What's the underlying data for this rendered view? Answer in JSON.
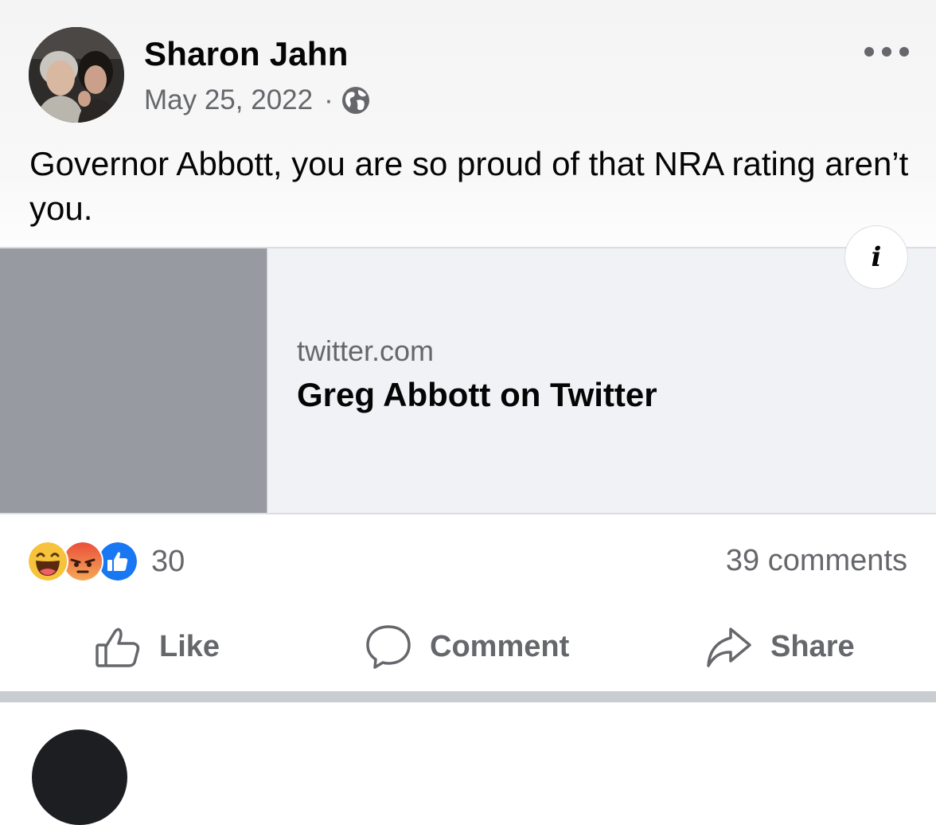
{
  "post": {
    "author": "Sharon Jahn",
    "date": "May 25, 2022",
    "separator_dot": "·",
    "privacy_icon": "globe-icon",
    "text": "Governor Abbott, you are so proud of that NRA rating aren’t you.",
    "link": {
      "domain": "twitter.com",
      "title": "Greg Abbott on Twitter",
      "info_glyph": "i"
    },
    "reactions": {
      "icons": [
        "haha-icon",
        "angry-icon",
        "like-icon"
      ],
      "count": "30"
    },
    "comments_count": "39 comments",
    "actions": {
      "like": "Like",
      "comment": "Comment",
      "share": "Share"
    }
  },
  "colors": {
    "secondary_text": "#65676b",
    "primary_text": "#050505",
    "like_blue": "#1877f2",
    "angry_orange": "#f0703c",
    "haha_yellow": "#f7c33c",
    "link_thumb": "#979aa0"
  }
}
